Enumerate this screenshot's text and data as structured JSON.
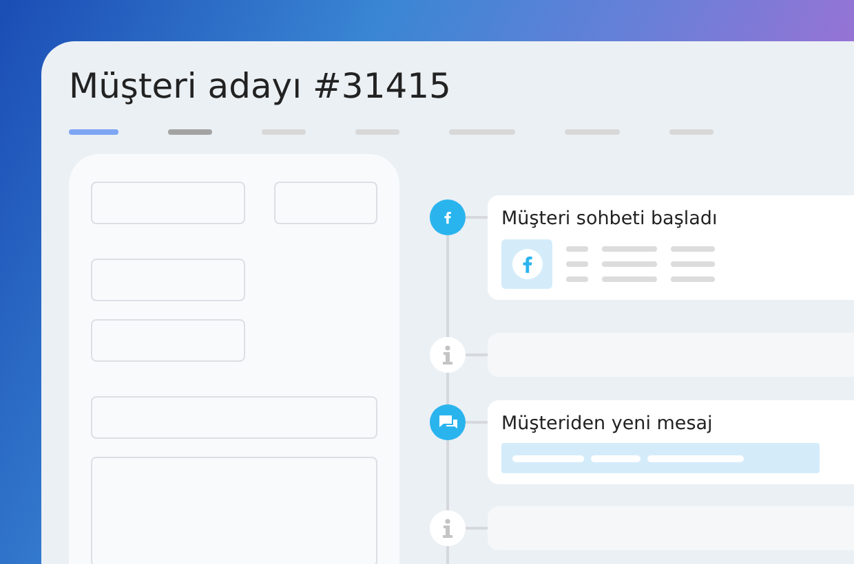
{
  "title": "Müşteri adayı #31415",
  "tabs": [
    {
      "selected": true,
      "hovered": false
    },
    {
      "selected": false,
      "hovered": true
    },
    {
      "selected": false,
      "hovered": false
    },
    {
      "selected": false,
      "hovered": false
    },
    {
      "selected": false,
      "hovered": false
    },
    {
      "selected": false,
      "hovered": false
    },
    {
      "selected": false,
      "hovered": false
    }
  ],
  "form": {
    "fields": [
      {
        "kind": "short"
      },
      {
        "kind": "tiny"
      },
      {
        "kind": "short"
      },
      {
        "kind": "short"
      },
      {
        "kind": "full"
      },
      {
        "kind": "area"
      }
    ]
  },
  "timeline": [
    {
      "kind": "facebook",
      "title": "Müşteri sohbeti başladı"
    },
    {
      "kind": "info"
    },
    {
      "kind": "message",
      "title": "Müşteriden yeni mesaj"
    },
    {
      "kind": "info"
    }
  ]
}
